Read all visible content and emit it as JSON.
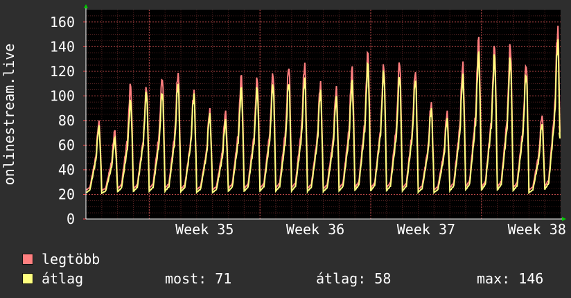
{
  "chart_data": {
    "type": "line",
    "ylabel": "onlinestream.live",
    "ylim": [
      0,
      170
    ],
    "yticks": [
      0,
      20,
      40,
      60,
      80,
      100,
      120,
      140,
      160
    ],
    "x_tick_labels": [
      "Week 35",
      "Week 36",
      "Week 37",
      "Week 38"
    ],
    "grid": true,
    "background_color": "#000000",
    "grid_color": "#8c3a3a",
    "legend_position": "bottom",
    "series": [
      {
        "name": "legtöbb",
        "color": "#ff7f7f",
        "daily_peaks": [
          80,
          72,
          110,
          108,
          117,
          120,
          105,
          90,
          88,
          117,
          115,
          120,
          126,
          127,
          112,
          108,
          124,
          136,
          126,
          130,
          122,
          95,
          88,
          128,
          148,
          141,
          143,
          128,
          85,
          157
        ]
      },
      {
        "name": "átlag",
        "color": "#ffff7f",
        "daily_peaks": [
          76,
          66,
          97,
          104,
          105,
          111,
          102,
          86,
          81,
          107,
          107,
          111,
          113,
          115,
          105,
          100,
          113,
          127,
          121,
          118,
          115,
          90,
          82,
          118,
          136,
          134,
          132,
          120,
          78,
          146
        ],
        "last": 71,
        "mean": 58,
        "max": 146
      }
    ]
  },
  "legend": {
    "max_label": "legtöbb",
    "avg_label": "átlag",
    "most_text": "most: 71",
    "avg_text": "átlag: 58",
    "max_text": "max: 146"
  }
}
